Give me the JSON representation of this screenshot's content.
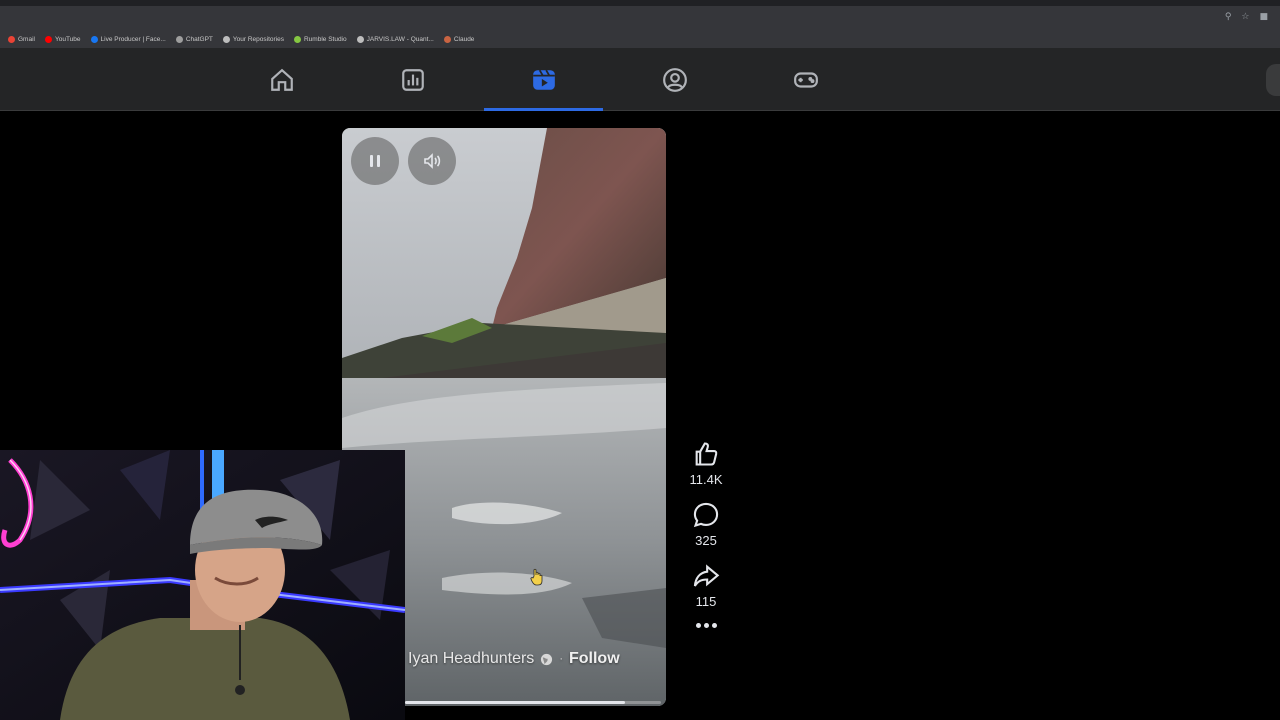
{
  "browser": {
    "bookmarks": [
      {
        "label": "Gmail",
        "color": "#ea4335"
      },
      {
        "label": "YouTube",
        "color": "#ff0000"
      },
      {
        "label": "Live Producer | Face...",
        "color": "#1877f2"
      },
      {
        "label": "ChatGPT",
        "color": "#9e9e9e"
      },
      {
        "label": "Your Repositories",
        "color": "#bdbdbd"
      },
      {
        "label": "Rumble Studio",
        "color": "#85c742"
      },
      {
        "label": "JARVIS.LAW - Quant...",
        "color": "#bdbdbd"
      },
      {
        "label": "Claude",
        "color": "#c96442"
      }
    ]
  },
  "nav": {
    "items": [
      {
        "name": "home",
        "icon": "home-icon",
        "active": false
      },
      {
        "name": "dashboard",
        "icon": "bar-chart-icon",
        "active": false
      },
      {
        "name": "reels",
        "icon": "reels-icon",
        "active": true
      },
      {
        "name": "profile",
        "icon": "person-circle-icon",
        "active": false
      },
      {
        "name": "gaming",
        "icon": "gamepad-icon",
        "active": false
      }
    ],
    "accent": "#2d6ae3"
  },
  "reel": {
    "author": "Iyan Headhunters",
    "follow_label": "Follow",
    "separator": "·",
    "progress": 0.86
  },
  "actions": {
    "likes": "11.4K",
    "comments": "325",
    "shares": "115"
  }
}
